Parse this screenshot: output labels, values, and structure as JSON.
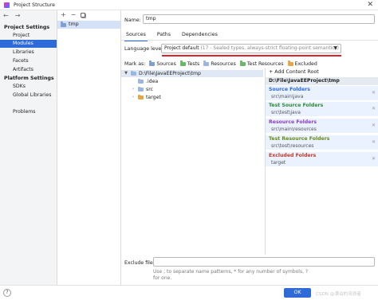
{
  "window": {
    "title": "Project Structure",
    "close_glyph": "✕"
  },
  "sidebar": {
    "nav_add": "+",
    "nav_remove": "−",
    "sections": [
      {
        "title": "Project Settings",
        "items": [
          "Project",
          "Modules",
          "Libraries",
          "Facets",
          "Artifacts"
        ]
      },
      {
        "title": "Platform Settings",
        "items": [
          "SDKs",
          "Global Libraries"
        ]
      }
    ],
    "problems": "Problems",
    "selected": "Modules"
  },
  "modules": {
    "toolbar": {
      "add": "+",
      "remove": "−"
    },
    "items": [
      "tmp"
    ]
  },
  "content": {
    "name_label": "Name:",
    "name_value": "tmp",
    "tabs": [
      "Sources",
      "Paths",
      "Dependencies"
    ],
    "active_tab": "Sources",
    "language_level_label": "Language level:",
    "language_level_value": "Project default",
    "language_level_detail": "(17 - Sealed types, always-strict floating-point semantics)",
    "mark_as_label": "Mark as:",
    "mark_as_buttons": [
      {
        "label": "Sources",
        "color": "#7e9fd4"
      },
      {
        "label": "Tests",
        "color": "#68b868"
      },
      {
        "label": "Resources",
        "color": "#9ab7e3"
      },
      {
        "label": "Test Resources",
        "color": "#68b868"
      },
      {
        "label": "Excluded",
        "color": "#e8a548"
      }
    ],
    "tree": [
      {
        "label": "D:\\File\\JavaEEProject\\tmp",
        "twist": "▼",
        "kind": "root"
      },
      {
        "label": ".idea",
        "twist": "",
        "kind": "folder"
      },
      {
        "label": "src",
        "twist": "›",
        "kind": "folder"
      },
      {
        "label": "target",
        "twist": "›",
        "kind": "excluded"
      }
    ],
    "add_content_root": "+ Add Content Root",
    "root_path": "D:\\File\\JavaEEProject\\tmp",
    "root_sections": [
      {
        "title": "Source Folders",
        "value": "src\\main\\java",
        "color": "#2f6bd8"
      },
      {
        "title": "Test Source Folders",
        "value": "src\\test\\java",
        "color": "#2e8b3a"
      },
      {
        "title": "Resource Folders",
        "value": "src\\main\\resources",
        "color": "#8a3fc4"
      },
      {
        "title": "Test Resource Folders",
        "value": "src\\test\\resources",
        "color": "#6a8a1a"
      },
      {
        "title": "Excluded Folders",
        "value": "target",
        "color": "#c0392b"
      }
    ],
    "exclude_files_label": "Exclude files:",
    "exclude_files_value": "",
    "exclude_hint": "Use ; to separate name patterns, * for any number of symbols, ? for one."
  },
  "footer": {
    "help": "?",
    "ok": "OK",
    "watermark": "CSDN @漂泊的流浪者"
  },
  "colors": {
    "accent": "#2f6bd8",
    "highlight_underline": "#e0202a"
  }
}
